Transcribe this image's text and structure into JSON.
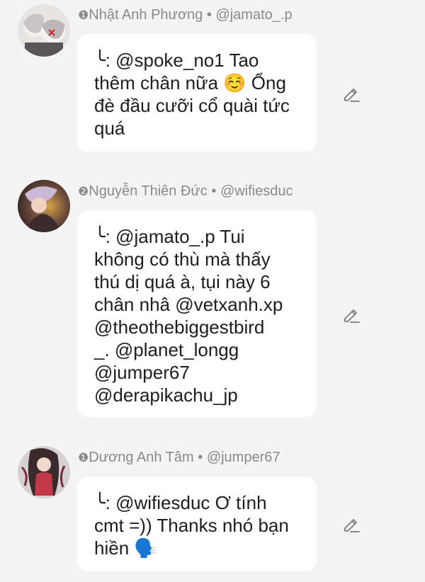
{
  "comments": [
    {
      "rank": "❶",
      "author": "Nhật Anh Phương",
      "separator": " • ",
      "handle": "@jamato_.p",
      "text": "╰: @spoke_no1 Tao\nthêm chân nữa ☺️ Ổng\nđè đầu cưỡi cổ quài tức\nquá",
      "avatar_icon": "anime-duo-avatar",
      "edit_icon": "pencil-icon"
    },
    {
      "rank": "❷",
      "author": "Nguyễn Thiên Đức",
      "separator": " • ",
      "handle": "@wifiesduc",
      "text": "╰: @jamato_.p Tui\nkhông có thù mà thấy\nthú dị quá à, tụi này 6\nchân nhâ @vetxanh.xp\n@theothebiggestbird\n_. @planet_longg\n@jumper67\n@derapikachu_jp",
      "avatar_icon": "anime-dark-avatar",
      "edit_icon": "pencil-icon"
    },
    {
      "rank": "❶",
      "author": "Dương Anh Tâm",
      "separator": " • ",
      "handle": "@jumper67",
      "text": "╰: @wifiesduc Ơ tính\ncmt =)) Thanks nhó bạn\nhiền 🗣️",
      "avatar_icon": "anime-girl-avatar",
      "edit_icon": "pencil-icon"
    }
  ],
  "colors": {
    "background": "#f4f4f4",
    "bubble": "#ffffff",
    "meta_text": "#8a8a8a",
    "body_text": "#1e1e1e"
  }
}
